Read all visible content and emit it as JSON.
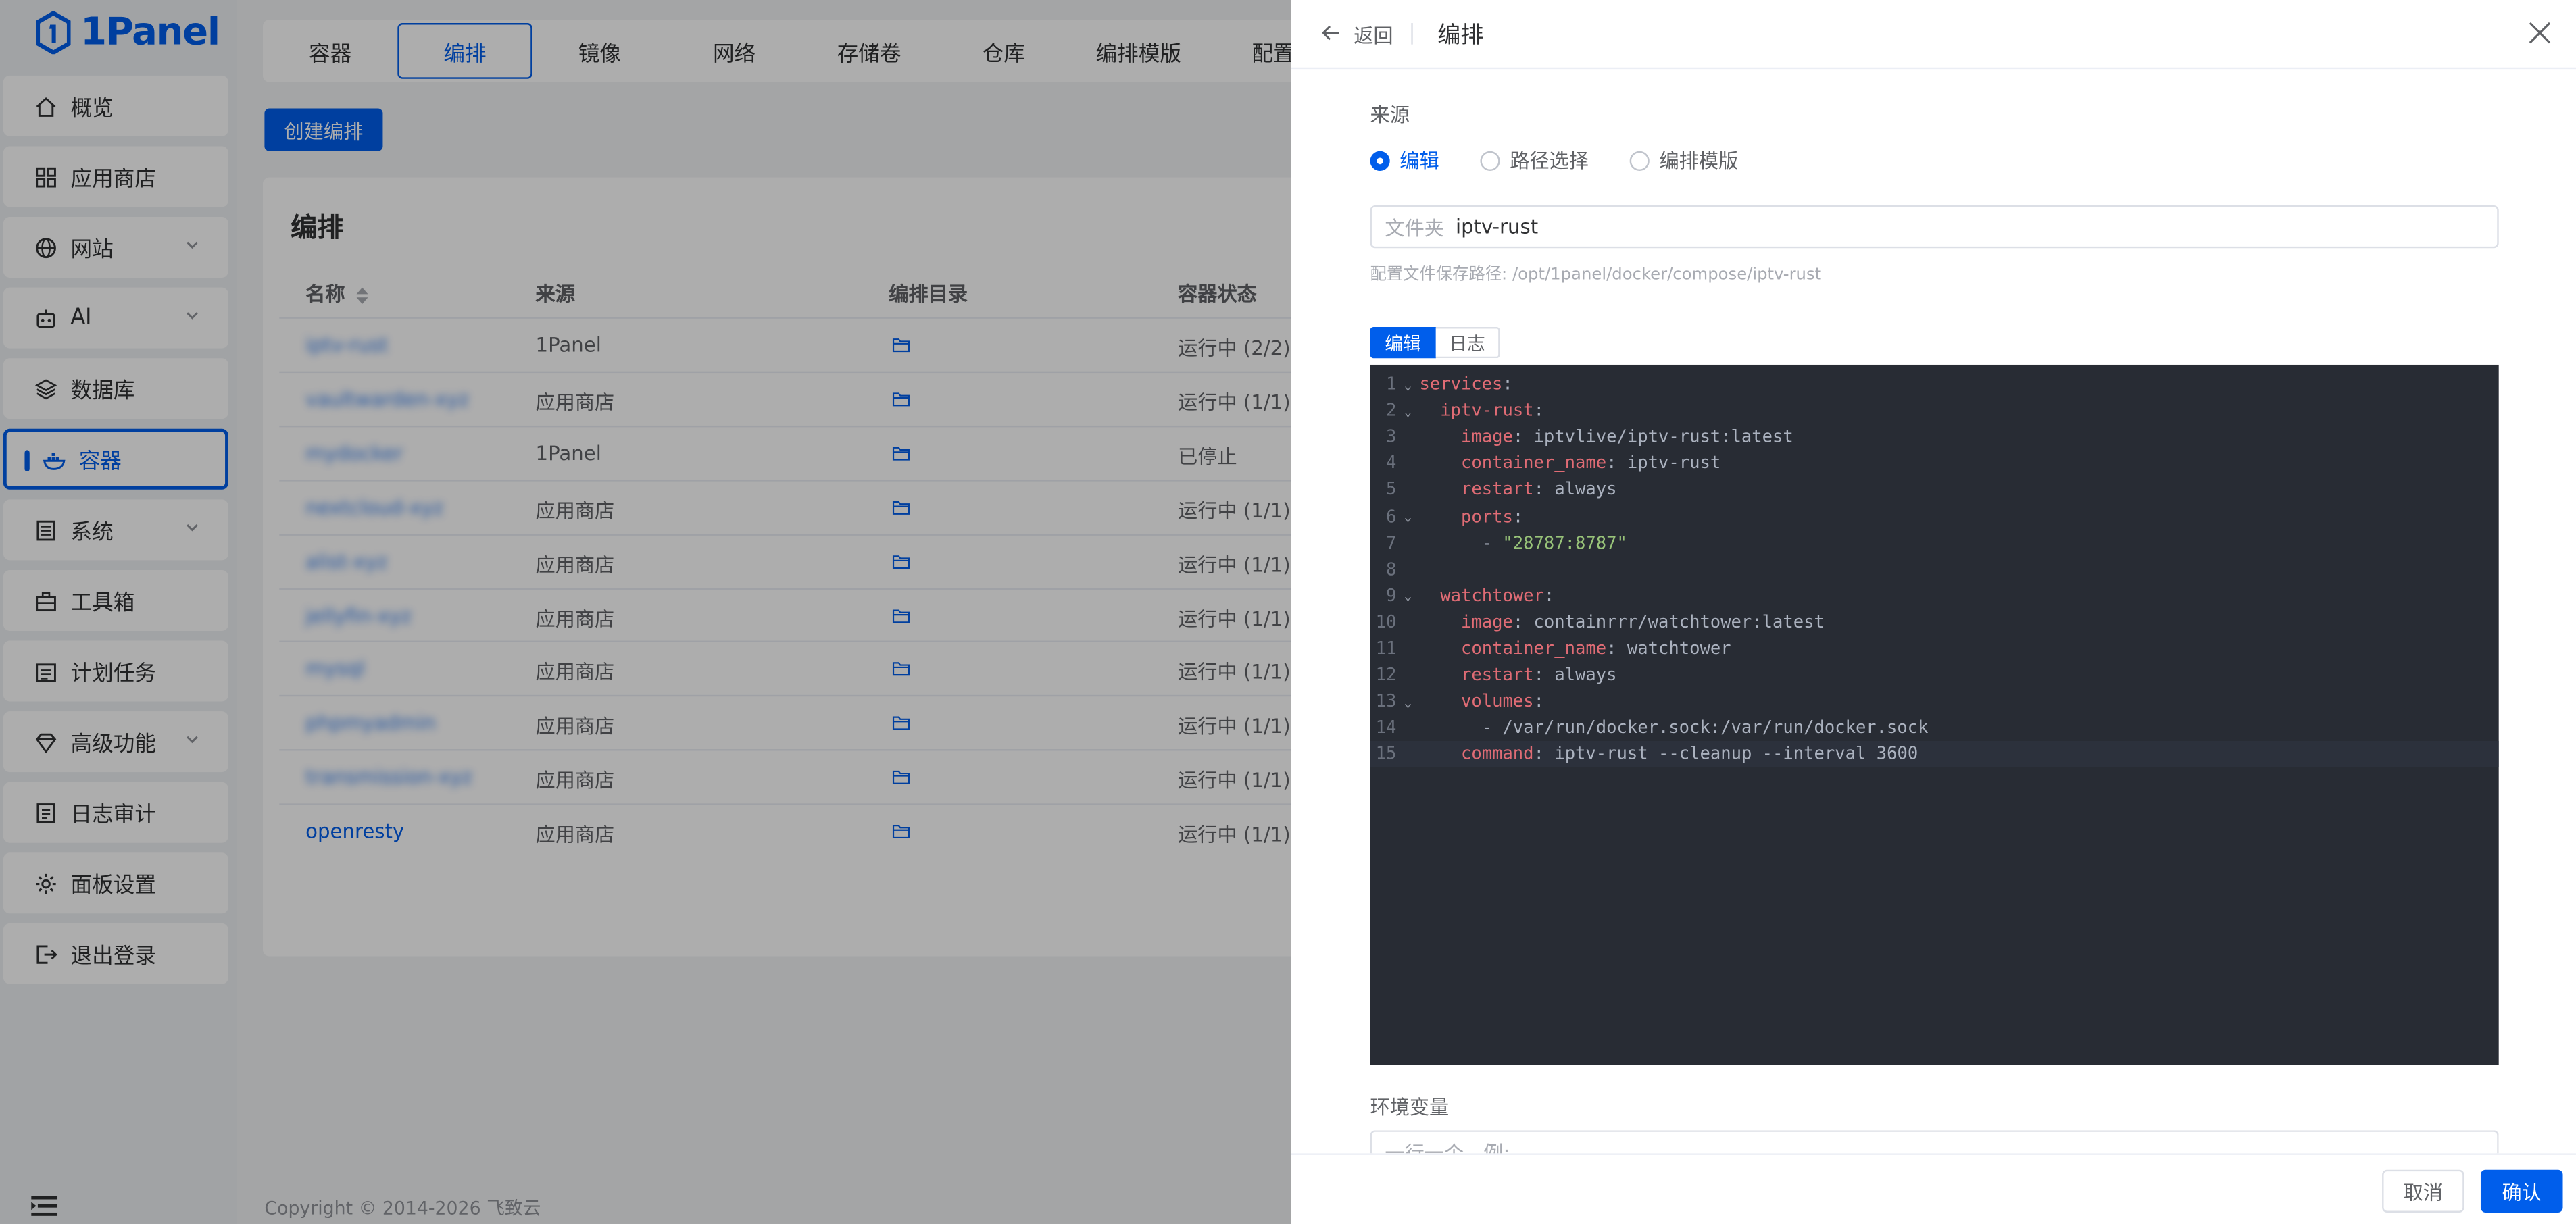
{
  "app": {
    "logo_text": "1Panel"
  },
  "sidebar": {
    "items": [
      {
        "label": "概览",
        "icon": "home-icon"
      },
      {
        "label": "应用商店",
        "icon": "grid-icon"
      },
      {
        "label": "网站",
        "icon": "globe-icon",
        "expandable": true
      },
      {
        "label": "AI",
        "icon": "robot-icon",
        "expandable": true
      },
      {
        "label": "数据库",
        "icon": "layers-icon"
      },
      {
        "label": "容器",
        "icon": "docker-icon",
        "active": true
      },
      {
        "label": "系统",
        "icon": "server-icon",
        "expandable": true
      },
      {
        "label": "工具箱",
        "icon": "toolbox-icon"
      },
      {
        "label": "计划任务",
        "icon": "calendar-icon"
      },
      {
        "label": "高级功能",
        "icon": "diamond-icon",
        "expandable": true
      },
      {
        "label": "日志审计",
        "icon": "log-icon"
      },
      {
        "label": "面板设置",
        "icon": "gear-icon"
      },
      {
        "label": "退出登录",
        "icon": "logout-icon"
      }
    ]
  },
  "main": {
    "tabs": [
      "容器",
      "编排",
      "镜像",
      "网络",
      "存储卷",
      "仓库",
      "编排模版",
      "配置"
    ],
    "active_tab": "编排",
    "create_button": "创建编排",
    "card_title": "编排",
    "columns": [
      "名称",
      "来源",
      "编排目录",
      "容器状态"
    ],
    "rows": [
      {
        "name": "iptv-rust",
        "source": "1Panel",
        "status": "运行中 (2/2)",
        "blurred": true
      },
      {
        "name": "vaultwarden-xyz",
        "source": "应用商店",
        "status": "运行中 (1/1)",
        "blurred": true
      },
      {
        "name": "mydocker",
        "source": "1Panel",
        "status": "已停止",
        "blurred": true
      },
      {
        "name": "nextcloud-xyz",
        "source": "应用商店",
        "status": "运行中 (1/1)",
        "blurred": true
      },
      {
        "name": "alist-xyz",
        "source": "应用商店",
        "status": "运行中 (1/1)",
        "blurred": true
      },
      {
        "name": "jellyfin-xyz",
        "source": "应用商店",
        "status": "运行中 (1/1)",
        "blurred": true
      },
      {
        "name": "mysql",
        "source": "应用商店",
        "status": "运行中 (1/1)",
        "blurred": true
      },
      {
        "name": "phpmyadmin",
        "source": "应用商店",
        "status": "运行中 (1/1)",
        "blurred": true
      },
      {
        "name": "transmission-xyz",
        "source": "应用商店",
        "status": "运行中 (1/1)",
        "blurred": true
      },
      {
        "name": "openresty",
        "source": "应用商店",
        "status": "运行中 (1/1)",
        "blurred": false
      }
    ],
    "footer": "Copyright © 2014-2026 飞致云"
  },
  "drawer": {
    "back_label": "返回",
    "title": "编排",
    "source_label": "来源",
    "radios": [
      {
        "label": "编辑",
        "checked": true
      },
      {
        "label": "路径选择",
        "checked": false
      },
      {
        "label": "编排模版",
        "checked": false
      }
    ],
    "folder_prefix": "文件夹",
    "folder_value": "iptv-rust",
    "path_hint": "配置文件保存路径: /opt/1panel/docker/compose/iptv-rust",
    "editor_tabs": [
      "编辑",
      "日志"
    ],
    "code_lines": [
      [
        {
          "t": "k",
          "v": "services"
        },
        {
          "t": "p",
          "v": ":"
        }
      ],
      [
        {
          "t": "p",
          "v": "  "
        },
        {
          "t": "k",
          "v": "iptv-rust"
        },
        {
          "t": "p",
          "v": ":"
        }
      ],
      [
        {
          "t": "p",
          "v": "    "
        },
        {
          "t": "k",
          "v": "image"
        },
        {
          "t": "p",
          "v": ": iptvlive/iptv-rust:latest"
        }
      ],
      [
        {
          "t": "p",
          "v": "    "
        },
        {
          "t": "k",
          "v": "container_name"
        },
        {
          "t": "p",
          "v": ": iptv-rust"
        }
      ],
      [
        {
          "t": "p",
          "v": "    "
        },
        {
          "t": "k",
          "v": "restart"
        },
        {
          "t": "p",
          "v": ": always"
        }
      ],
      [
        {
          "t": "p",
          "v": "    "
        },
        {
          "t": "k",
          "v": "ports"
        },
        {
          "t": "p",
          "v": ":"
        }
      ],
      [
        {
          "t": "p",
          "v": "      - "
        },
        {
          "t": "s",
          "v": "\"28787:8787\""
        }
      ],
      [],
      [
        {
          "t": "p",
          "v": "  "
        },
        {
          "t": "k",
          "v": "watchtower"
        },
        {
          "t": "p",
          "v": ":"
        }
      ],
      [
        {
          "t": "p",
          "v": "    "
        },
        {
          "t": "k",
          "v": "image"
        },
        {
          "t": "p",
          "v": ": containrrr/watchtower:latest"
        }
      ],
      [
        {
          "t": "p",
          "v": "    "
        },
        {
          "t": "k",
          "v": "container_name"
        },
        {
          "t": "p",
          "v": ": watchtower"
        }
      ],
      [
        {
          "t": "p",
          "v": "    "
        },
        {
          "t": "k",
          "v": "restart"
        },
        {
          "t": "p",
          "v": ": always"
        }
      ],
      [
        {
          "t": "p",
          "v": "    "
        },
        {
          "t": "k",
          "v": "volumes"
        },
        {
          "t": "p",
          "v": ":"
        }
      ],
      [
        {
          "t": "p",
          "v": "      - /var/run/docker.sock:/var/run/docker.sock"
        }
      ],
      [
        {
          "t": "p",
          "v": "    "
        },
        {
          "t": "k",
          "v": "command"
        },
        {
          "t": "p",
          "v": ": iptv-rust --cleanup --interval 3600"
        }
      ]
    ],
    "fold_lines": [
      1,
      2,
      6,
      9,
      13
    ],
    "active_line": 15,
    "env_label": "环境变量",
    "env_placeholder": "一行一个，例:",
    "cancel": "取消",
    "confirm": "确认"
  }
}
